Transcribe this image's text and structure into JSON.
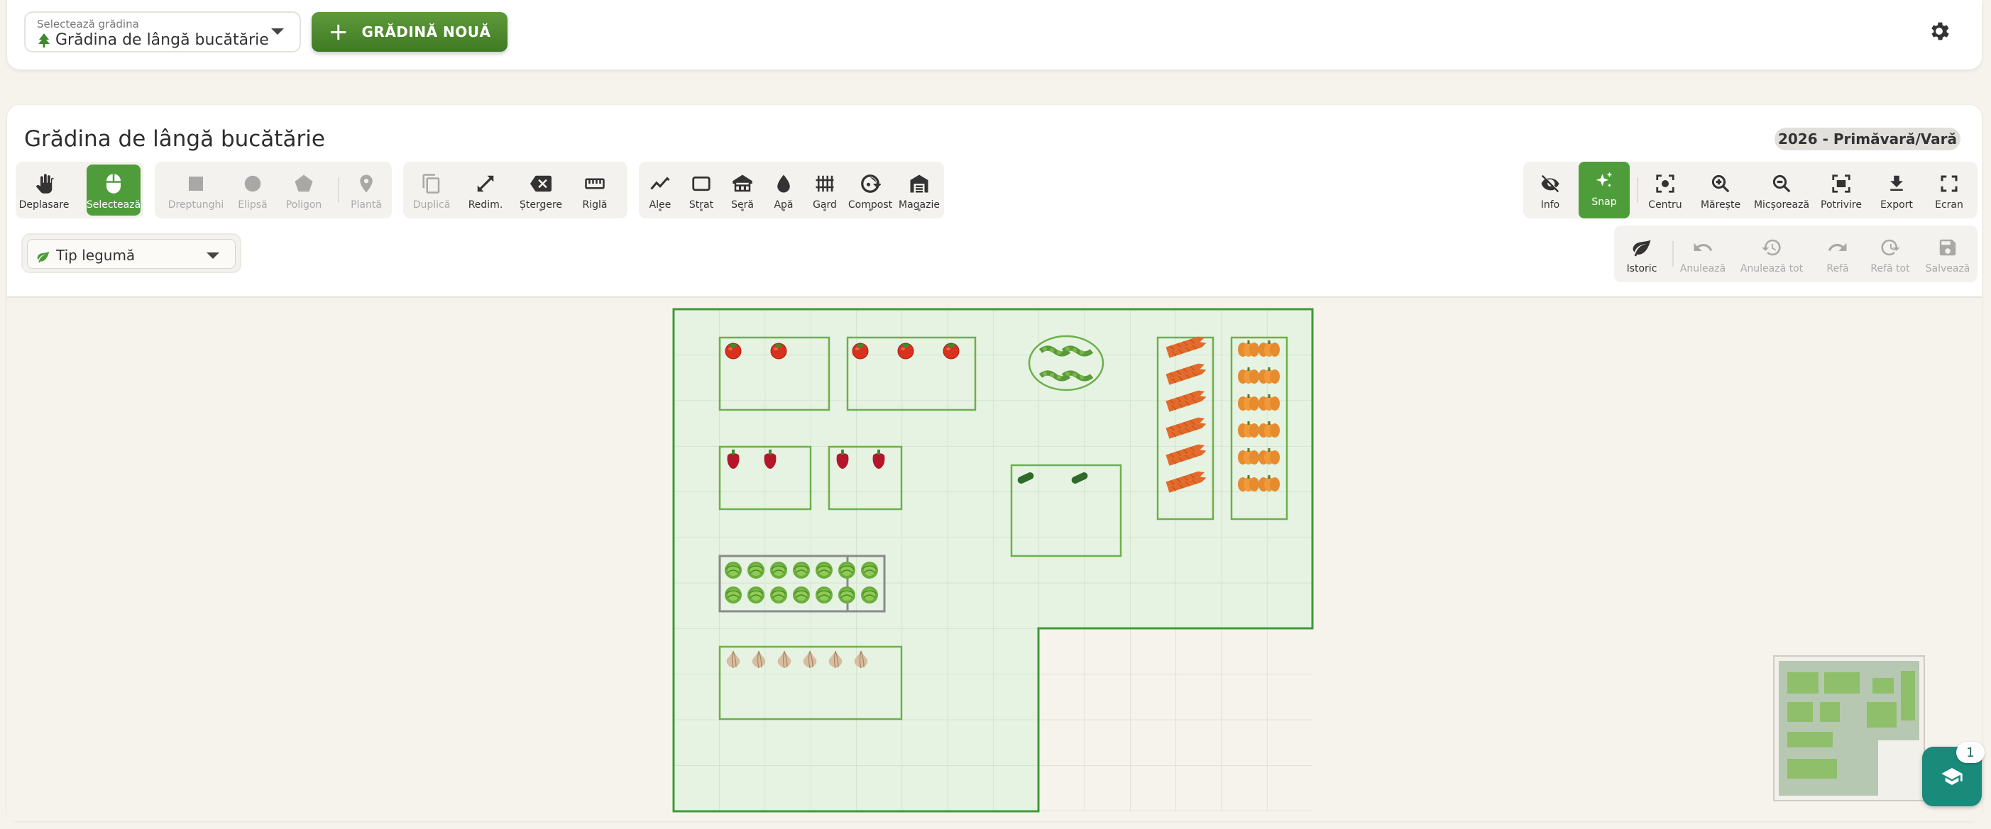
{
  "header": {
    "select_label": "Selectează grădina",
    "selected_garden": "Grădina de lângă bucătărie",
    "new_button": "GRĂDINĂ NOUĂ"
  },
  "garden": {
    "title": "Grădina de lângă bucătărie",
    "season": "2026 - Primăvară/Vară"
  },
  "toolbar": {
    "mode": [
      {
        "label": "Deplasare",
        "icon": "hand-icon"
      },
      {
        "label": "Selectează",
        "icon": "mouse-icon",
        "active": true
      }
    ],
    "shapes": [
      {
        "label": "Dreptunghi",
        "icon": "square-icon"
      },
      {
        "label": "Elipsă",
        "icon": "circle-icon"
      },
      {
        "label": "Poligon",
        "icon": "pentagon-icon"
      },
      {
        "label": "Plantă",
        "icon": "pin-icon"
      }
    ],
    "edit": [
      {
        "label": "Duplică",
        "icon": "copy-icon"
      },
      {
        "label": "Redim.",
        "icon": "resize-icon"
      },
      {
        "label": "Ștergere",
        "icon": "backspace-icon"
      },
      {
        "label": "Riglă",
        "icon": "ruler-icon"
      }
    ],
    "elements": [
      {
        "label": "Alee",
        "icon": "path-icon"
      },
      {
        "label": "Strat",
        "icon": "bed-icon"
      },
      {
        "label": "Seră",
        "icon": "greenhouse-icon"
      },
      {
        "label": "Apă",
        "icon": "drop-icon"
      },
      {
        "label": "Gard",
        "icon": "fence-icon"
      },
      {
        "label": "Compost",
        "icon": "compost-icon"
      },
      {
        "label": "Magazie",
        "icon": "shed-icon"
      }
    ],
    "view": [
      {
        "label": "Info",
        "icon": "eye-off-icon"
      },
      {
        "label": "Snap",
        "icon": "sparkle-icon",
        "active": true
      },
      {
        "label": "Centru",
        "icon": "center-icon"
      },
      {
        "label": "Mărește",
        "icon": "zoom-in-icon"
      },
      {
        "label": "Micșorează",
        "icon": "zoom-out-icon"
      },
      {
        "label": "Potrivire",
        "icon": "fit-icon"
      },
      {
        "label": "Export",
        "icon": "download-icon"
      },
      {
        "label": "Ecran",
        "icon": "fullscreen-icon"
      }
    ],
    "history": [
      {
        "label": "Istoric",
        "icon": "leaf-icon"
      },
      {
        "label": "Anulează",
        "icon": "undo-icon"
      },
      {
        "label": "Anulează tot",
        "icon": "history-icon"
      },
      {
        "label": "Refă",
        "icon": "redo-icon"
      },
      {
        "label": "Refă tot",
        "icon": "redo-all-icon"
      },
      {
        "label": "Salvează",
        "icon": "save-icon"
      }
    ]
  },
  "filter": {
    "label": "Tip legumă"
  },
  "help": {
    "badge": "1"
  },
  "colors": {
    "accent": "#4f9d3a",
    "garden_fill": "#e6f3e3",
    "bed_border": "#6db04b"
  }
}
